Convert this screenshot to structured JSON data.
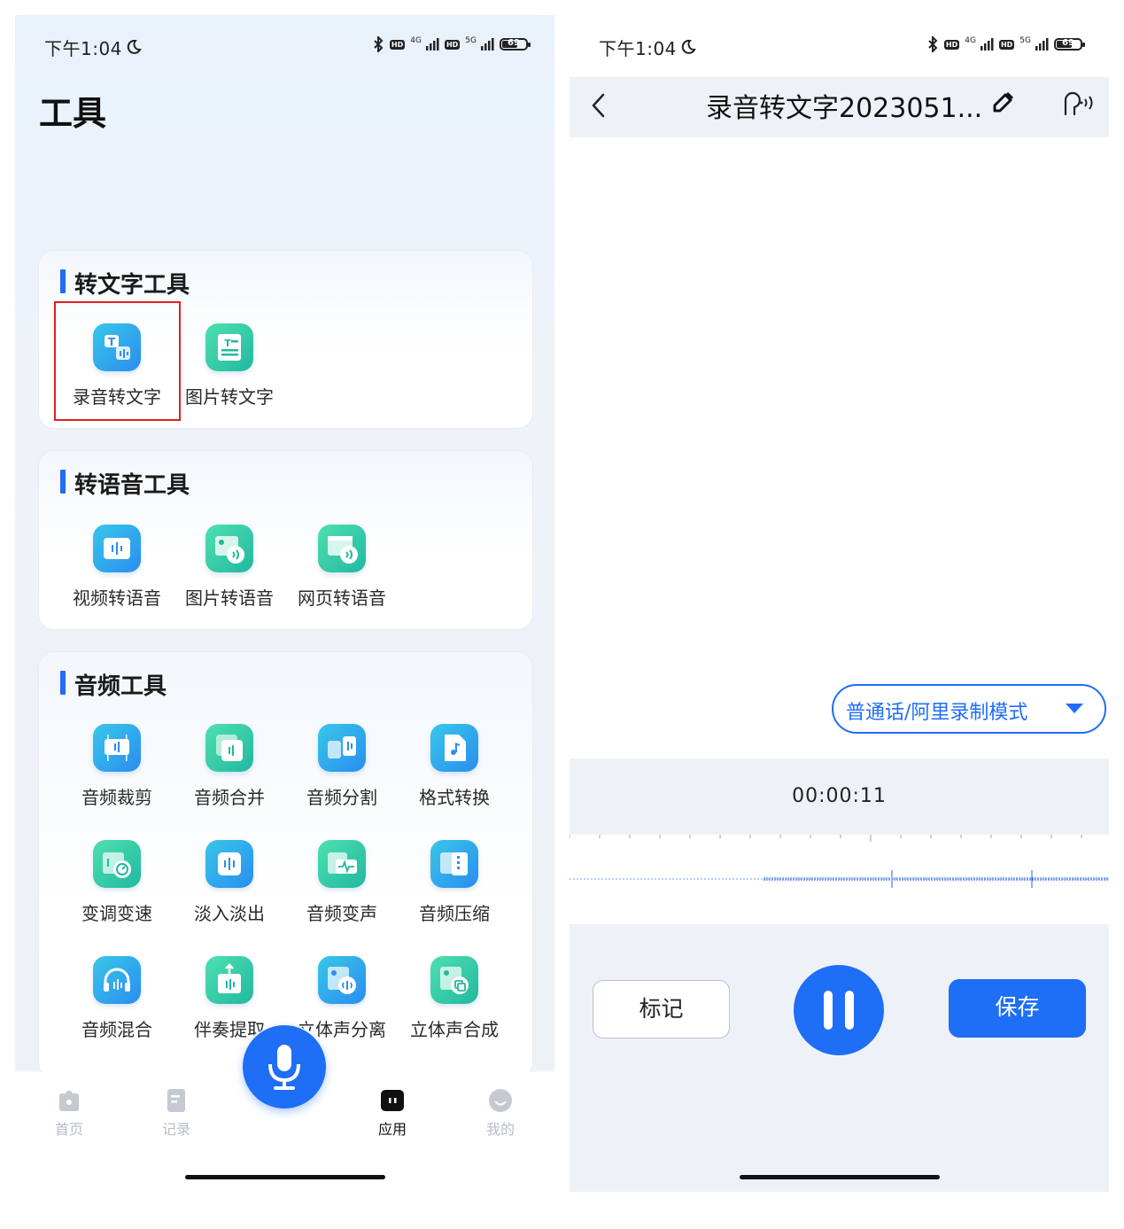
{
  "left_screen": {
    "status_bar": {
      "time": "下午1:04",
      "net_a": "4G",
      "net_b": "5G",
      "hd": "HD",
      "battery": "69",
      "battery_level": 0.69
    },
    "page_title": "工具",
    "sections": [
      {
        "title": "转文字工具",
        "tools": [
          {
            "label": "录音转文字",
            "icon": "audio-to-text-icon",
            "selected": true
          },
          {
            "label": "图片转文字",
            "icon": "image-to-text-icon"
          }
        ]
      },
      {
        "title": "转语音工具",
        "tools": [
          {
            "label": "视频转语音",
            "icon": "video-to-speech-icon"
          },
          {
            "label": "图片转语音",
            "icon": "image-to-speech-icon"
          },
          {
            "label": "网页转语音",
            "icon": "webpage-to-speech-icon"
          }
        ]
      },
      {
        "title": "音频工具",
        "tools": [
          {
            "label": "音频裁剪",
            "icon": "audio-trim-icon"
          },
          {
            "label": "音频合并",
            "icon": "audio-merge-icon"
          },
          {
            "label": "音频分割",
            "icon": "audio-split-icon"
          },
          {
            "label": "格式转换",
            "icon": "format-convert-icon"
          },
          {
            "label": "变调变速",
            "icon": "pitch-speed-icon"
          },
          {
            "label": "淡入淡出",
            "icon": "fade-in-out-icon"
          },
          {
            "label": "音频变声",
            "icon": "voice-change-icon"
          },
          {
            "label": "音频压缩",
            "icon": "audio-compress-icon"
          },
          {
            "label": "音频混合",
            "icon": "audio-mix-icon"
          },
          {
            "label": "伴奏提取",
            "icon": "accompaniment-extract-icon"
          },
          {
            "label": "立体声分离",
            "icon": "stereo-separate-icon"
          },
          {
            "label": "立体声合成",
            "icon": "stereo-combine-icon"
          }
        ]
      }
    ],
    "tabbar": {
      "tabs": [
        {
          "label": "首页",
          "icon": "home-icon",
          "active": false
        },
        {
          "label": "记录",
          "icon": "record-icon",
          "active": false
        },
        {
          "label": "应用",
          "icon": "apps-icon",
          "active": true
        },
        {
          "label": "我的",
          "icon": "profile-icon",
          "active": false
        }
      ],
      "mic_icon": "microphone-icon"
    }
  },
  "right_screen": {
    "status_bar": {
      "time": "下午1:04",
      "net_a": "4G",
      "net_b": "5G",
      "hd": "HD",
      "battery": "69",
      "battery_level": 0.69
    },
    "title": "录音转文字2023051...",
    "language_mode": "普通话/阿里录制模式",
    "timer": "00:00:11",
    "mark_button": "标记",
    "save_button": "保存"
  },
  "colors": {
    "accent": "#1e6ef6",
    "highlight": "#e02020"
  }
}
